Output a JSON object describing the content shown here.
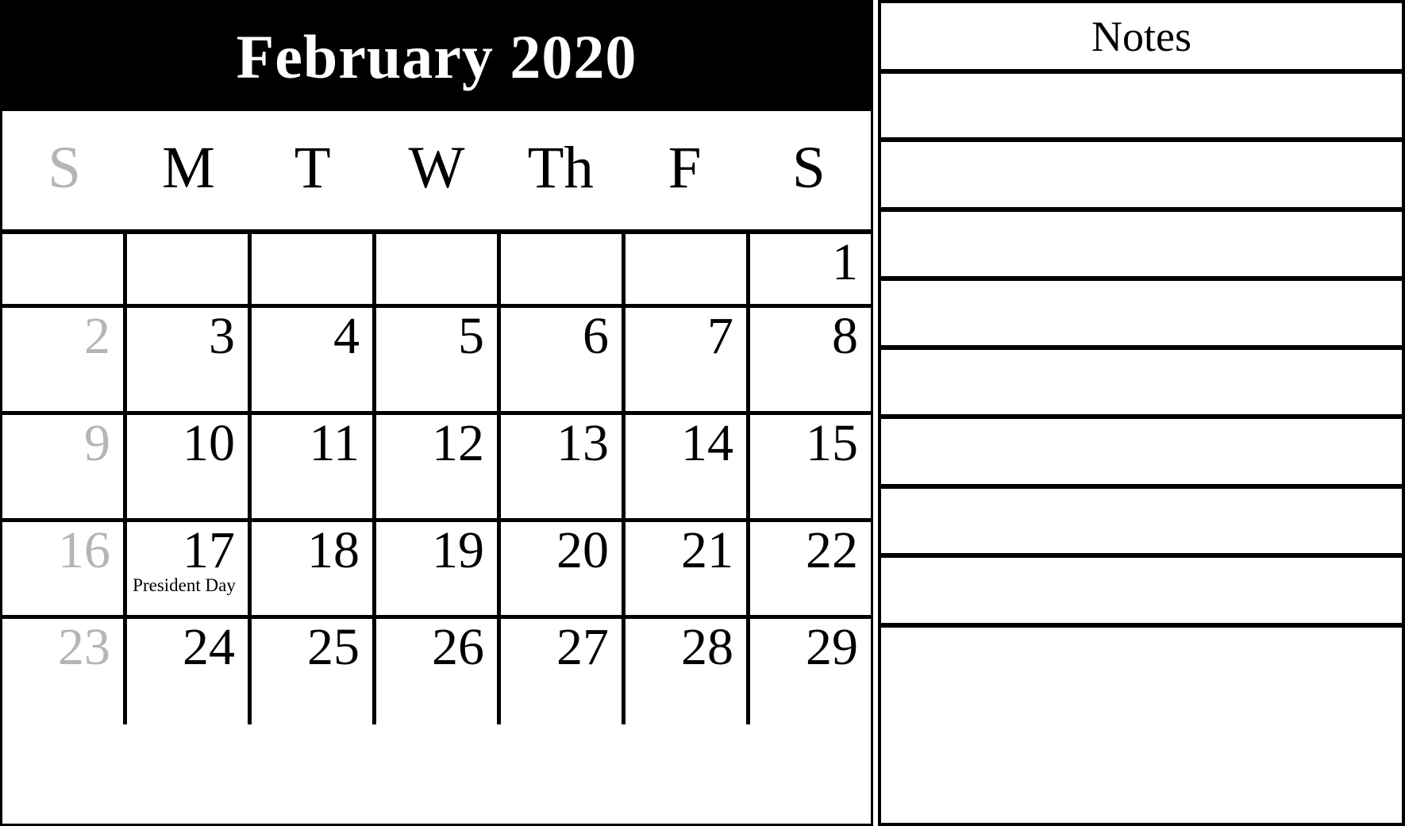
{
  "calendar": {
    "title": "February 2020",
    "month": "February",
    "year": "2020",
    "weekday_headers": [
      {
        "label": "S",
        "weekend": true
      },
      {
        "label": "M",
        "weekend": false
      },
      {
        "label": "T",
        "weekend": false
      },
      {
        "label": "W",
        "weekend": false
      },
      {
        "label": "Th",
        "weekend": false
      },
      {
        "label": "F",
        "weekend": false
      },
      {
        "label": "S",
        "weekend": false
      }
    ],
    "weeks": [
      [
        {
          "day": "",
          "weekend": true,
          "event": ""
        },
        {
          "day": "",
          "weekend": false,
          "event": ""
        },
        {
          "day": "",
          "weekend": false,
          "event": ""
        },
        {
          "day": "",
          "weekend": false,
          "event": ""
        },
        {
          "day": "",
          "weekend": false,
          "event": ""
        },
        {
          "day": "",
          "weekend": false,
          "event": ""
        },
        {
          "day": "1",
          "weekend": false,
          "event": ""
        }
      ],
      [
        {
          "day": "2",
          "weekend": true,
          "event": ""
        },
        {
          "day": "3",
          "weekend": false,
          "event": ""
        },
        {
          "day": "4",
          "weekend": false,
          "event": ""
        },
        {
          "day": "5",
          "weekend": false,
          "event": ""
        },
        {
          "day": "6",
          "weekend": false,
          "event": ""
        },
        {
          "day": "7",
          "weekend": false,
          "event": ""
        },
        {
          "day": "8",
          "weekend": false,
          "event": ""
        }
      ],
      [
        {
          "day": "9",
          "weekend": true,
          "event": ""
        },
        {
          "day": "10",
          "weekend": false,
          "event": ""
        },
        {
          "day": "11",
          "weekend": false,
          "event": ""
        },
        {
          "day": "12",
          "weekend": false,
          "event": ""
        },
        {
          "day": "13",
          "weekend": false,
          "event": ""
        },
        {
          "day": "14",
          "weekend": false,
          "event": ""
        },
        {
          "day": "15",
          "weekend": false,
          "event": ""
        }
      ],
      [
        {
          "day": "16",
          "weekend": true,
          "event": ""
        },
        {
          "day": "17",
          "weekend": false,
          "event": "President Day"
        },
        {
          "day": "18",
          "weekend": false,
          "event": ""
        },
        {
          "day": "19",
          "weekend": false,
          "event": ""
        },
        {
          "day": "20",
          "weekend": false,
          "event": ""
        },
        {
          "day": "21",
          "weekend": false,
          "event": ""
        },
        {
          "day": "22",
          "weekend": false,
          "event": ""
        }
      ],
      [
        {
          "day": "23",
          "weekend": true,
          "event": ""
        },
        {
          "day": "24",
          "weekend": false,
          "event": ""
        },
        {
          "day": "25",
          "weekend": false,
          "event": ""
        },
        {
          "day": "26",
          "weekend": false,
          "event": ""
        },
        {
          "day": "27",
          "weekend": false,
          "event": ""
        },
        {
          "day": "28",
          "weekend": false,
          "event": ""
        },
        {
          "day": "29",
          "weekend": false,
          "event": ""
        }
      ],
      [
        {
          "day": "",
          "weekend": true,
          "event": ""
        },
        {
          "day": "",
          "weekend": false,
          "event": ""
        },
        {
          "day": "",
          "weekend": false,
          "event": ""
        },
        {
          "day": "",
          "weekend": false,
          "event": ""
        },
        {
          "day": "",
          "weekend": false,
          "event": ""
        },
        {
          "day": "",
          "weekend": false,
          "event": ""
        },
        {
          "day": "",
          "weekend": false,
          "event": ""
        }
      ]
    ]
  },
  "notes": {
    "title": "Notes",
    "lines": [
      "",
      "",
      "",
      "",
      "",
      "",
      "",
      "",
      ""
    ]
  },
  "colors": {
    "header_background": "#000000",
    "header_text": "#ffffff",
    "grid_line": "#000000",
    "weekend_text": "#b5b5b5",
    "weekday_text": "#000000",
    "page_background": "#ffffff"
  }
}
